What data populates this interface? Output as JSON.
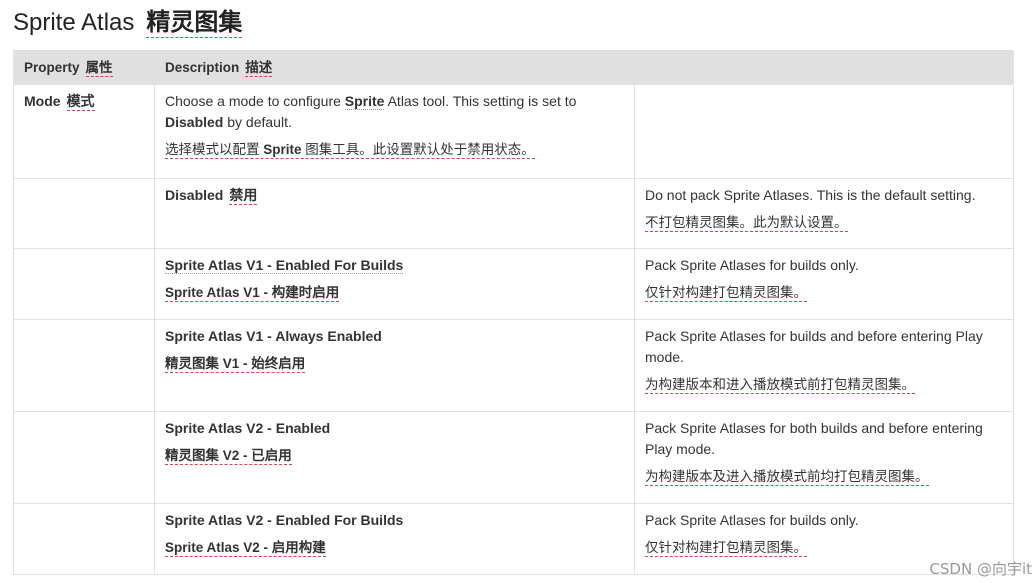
{
  "title": {
    "en": "Sprite Atlas",
    "zh": "精灵图集"
  },
  "table": {
    "headers": {
      "property_en": "Property",
      "property_zh": "属性",
      "description_en": "Description",
      "description_zh": "描述"
    },
    "mode_row": {
      "label_en": "Mode",
      "label_zh": "模式",
      "desc_en_pre": "Choose a mode to configure ",
      "desc_en_bold1": "Sprite",
      "desc_en_mid": " Atlas tool. This setting is set to ",
      "desc_en_bold2": "Disabled",
      "desc_en_post": " by default.",
      "desc_zh_pre": "选择模式以配置 ",
      "desc_zh_bold": "Sprite",
      "desc_zh_post": " 图集工具。此设置默认处于禁用状态。"
    },
    "options": [
      {
        "name_en": "Disabled",
        "name_zh": "禁用",
        "desc_en": "Do not pack Sprite Atlases. This is the default setting.",
        "desc_zh": "不打包精灵图集。此为默认设置。"
      },
      {
        "name_en": "Sprite Atlas V1 - Enabled For Builds",
        "name_zh": "Sprite Atlas V1 - 构建时启用",
        "desc_en": "Pack Sprite Atlases for builds only.",
        "desc_zh": "仅针对构建打包精灵图集。"
      },
      {
        "name_en": "Sprite Atlas V1 - Always Enabled",
        "name_zh": "精灵图集 V1 - 始终启用",
        "desc_en": "Pack Sprite Atlases for builds and before entering Play mode.",
        "desc_zh": "为构建版本和进入播放模式前打包精灵图集。"
      },
      {
        "name_en": "Sprite Atlas V2 - Enabled",
        "name_zh": "精灵图集 V2 - 已启用",
        "desc_en": "Pack Sprite Atlases for both builds and before entering Play mode.",
        "desc_zh": "为构建版本及进入播放模式前均打包精灵图集。"
      },
      {
        "name_en": "Sprite Atlas V2 - Enabled For Builds",
        "name_zh": "Sprite Atlas V2 - 启用构建",
        "desc_en": "Pack Sprite Atlases for builds only.",
        "desc_zh": "仅针对构建打包精灵图集。"
      }
    ]
  },
  "watermark": "CSDN @向宇it"
}
